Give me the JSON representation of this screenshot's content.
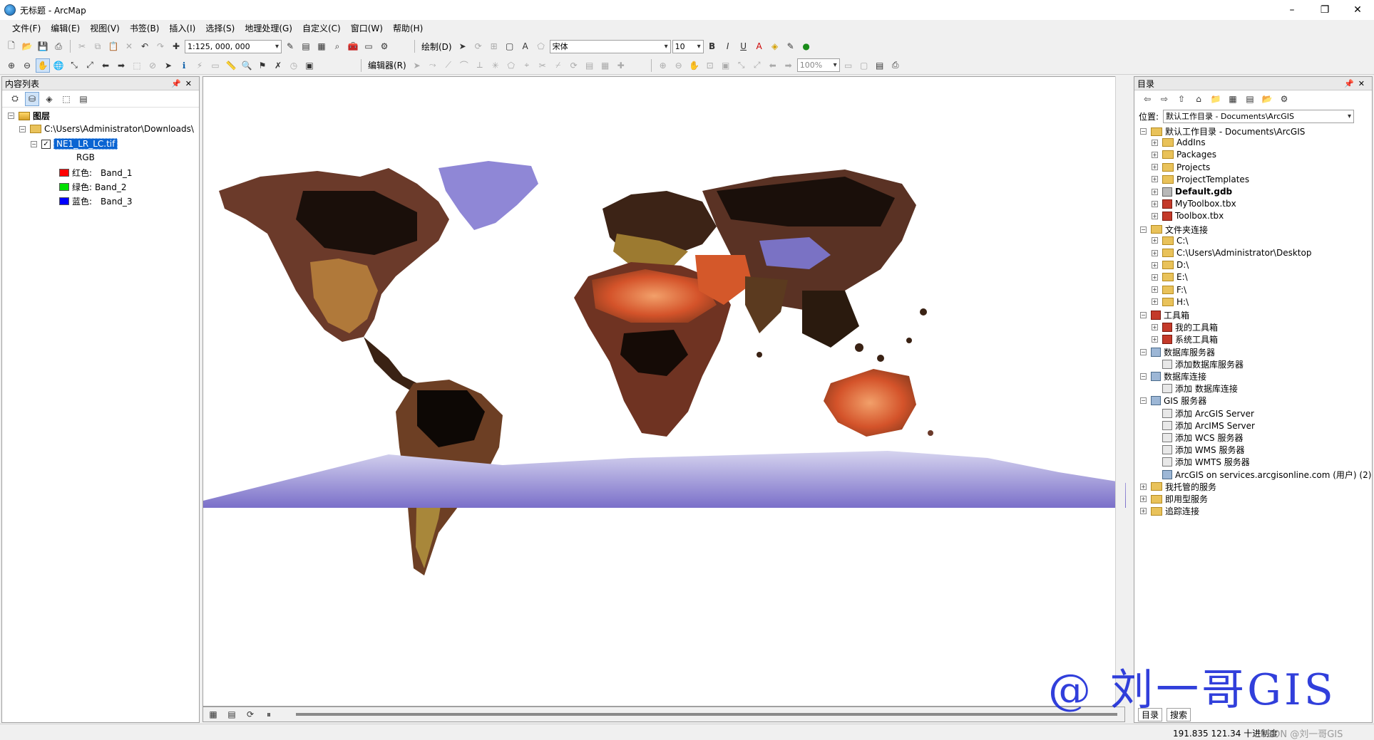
{
  "window": {
    "title": "无标题 - ArcMap",
    "controls": [
      "–",
      "❐",
      "✕"
    ]
  },
  "menu": [
    "文件(F)",
    "编辑(E)",
    "视图(V)",
    "书签(B)",
    "插入(I)",
    "选择(S)",
    "地理处理(G)",
    "自定义(C)",
    "窗口(W)",
    "帮助(H)"
  ],
  "toolbar1": {
    "scale": "1:125, 000, 000",
    "draw_label": "绘制(D)",
    "font_name": "宋体",
    "font_size": "10"
  },
  "toolbar2": {
    "editor_label": "编辑器(R)",
    "zoom_pct": "100%"
  },
  "toc": {
    "header": "内容列表",
    "root": "图层",
    "folder": "C:\\Users\\Administrator\\Downloads\\",
    "layer": "NE1_LR_LC.tif",
    "rgb": "RGB",
    "bands": [
      {
        "label": "红色:",
        "band": "Band_1",
        "color": "#ff0000"
      },
      {
        "label": "绿色:",
        "band": "Band_2",
        "color": "#00e000"
      },
      {
        "label": "蓝色:",
        "band": "Band_3",
        "color": "#0000ff"
      }
    ]
  },
  "catalog": {
    "header": "目录",
    "location_label": "位置:",
    "location_value": "默认工作目录 - Documents\\ArcGIS",
    "items": [
      {
        "label": "默认工作目录 - Documents\\ArcGIS",
        "level": 0,
        "icon": "folder-home-icon",
        "box": "−"
      },
      {
        "label": "AddIns",
        "level": 1,
        "icon": "folder-icon",
        "box": "+"
      },
      {
        "label": "Packages",
        "level": 1,
        "icon": "folder-icon",
        "box": "+"
      },
      {
        "label": "Projects",
        "level": 1,
        "icon": "folder-icon",
        "box": "+"
      },
      {
        "label": "ProjectTemplates",
        "level": 1,
        "icon": "folder-icon",
        "box": "+"
      },
      {
        "label": "Default.gdb",
        "level": 1,
        "icon": "geodatabase-icon",
        "box": "+",
        "bold": true
      },
      {
        "label": "MyToolbox.tbx",
        "level": 1,
        "icon": "toolbox-icon",
        "box": "+"
      },
      {
        "label": "Toolbox.tbx",
        "level": 1,
        "icon": "toolbox-icon",
        "box": "+"
      },
      {
        "label": "文件夹连接",
        "level": 0,
        "icon": "folder-connection-icon",
        "box": "−"
      },
      {
        "label": "C:\\",
        "level": 1,
        "icon": "folder-icon",
        "box": "+"
      },
      {
        "label": "C:\\Users\\Administrator\\Desktop",
        "level": 1,
        "icon": "folder-icon",
        "box": "+"
      },
      {
        "label": "D:\\",
        "level": 1,
        "icon": "folder-icon",
        "box": "+"
      },
      {
        "label": "E:\\",
        "level": 1,
        "icon": "folder-icon",
        "box": "+"
      },
      {
        "label": "F:\\",
        "level": 1,
        "icon": "folder-icon",
        "box": "+"
      },
      {
        "label": "H:\\",
        "level": 1,
        "icon": "folder-icon",
        "box": "+"
      },
      {
        "label": "工具箱",
        "level": 0,
        "icon": "toolbox-icon",
        "box": "−"
      },
      {
        "label": "我的工具箱",
        "level": 1,
        "icon": "toolbox-icon",
        "box": "+"
      },
      {
        "label": "系统工具箱",
        "level": 1,
        "icon": "toolbox-icon",
        "box": "+"
      },
      {
        "label": "数据库服务器",
        "level": 0,
        "icon": "db-server-icon",
        "box": "−"
      },
      {
        "label": "添加数据库服务器",
        "level": 1,
        "icon": "add-icon",
        "box": ""
      },
      {
        "label": "数据库连接",
        "level": 0,
        "icon": "db-connection-icon",
        "box": "−"
      },
      {
        "label": "添加 数据库连接",
        "level": 1,
        "icon": "add-icon",
        "box": ""
      },
      {
        "label": "GIS 服务器",
        "level": 0,
        "icon": "server-icon",
        "box": "−"
      },
      {
        "label": "添加 ArcGIS Server",
        "level": 1,
        "icon": "add-icon",
        "box": ""
      },
      {
        "label": "添加 ArcIMS Server",
        "level": 1,
        "icon": "add-icon",
        "box": ""
      },
      {
        "label": "添加 WCS 服务器",
        "level": 1,
        "icon": "add-icon",
        "box": ""
      },
      {
        "label": "添加 WMS 服务器",
        "level": 1,
        "icon": "add-icon",
        "box": ""
      },
      {
        "label": "添加 WMTS 服务器",
        "level": 1,
        "icon": "add-icon",
        "box": ""
      },
      {
        "label": "ArcGIS on services.arcgisonline.com (用户) (2)",
        "level": 1,
        "icon": "server-icon",
        "box": ""
      },
      {
        "label": "我托管的服务",
        "level": 0,
        "icon": "folder-icon",
        "box": "+"
      },
      {
        "label": "即用型服务",
        "level": 0,
        "icon": "folder-icon",
        "box": "+"
      },
      {
        "label": "追踪连接",
        "level": 0,
        "icon": "folder-icon",
        "box": "+"
      }
    ],
    "tabs": [
      "目录",
      "搜索"
    ]
  },
  "status": {
    "coords": "191.835  121.34 十进制度",
    "csdn": "CSDN @刘一哥GIS"
  },
  "watermark": "@ 刘一哥GIS"
}
